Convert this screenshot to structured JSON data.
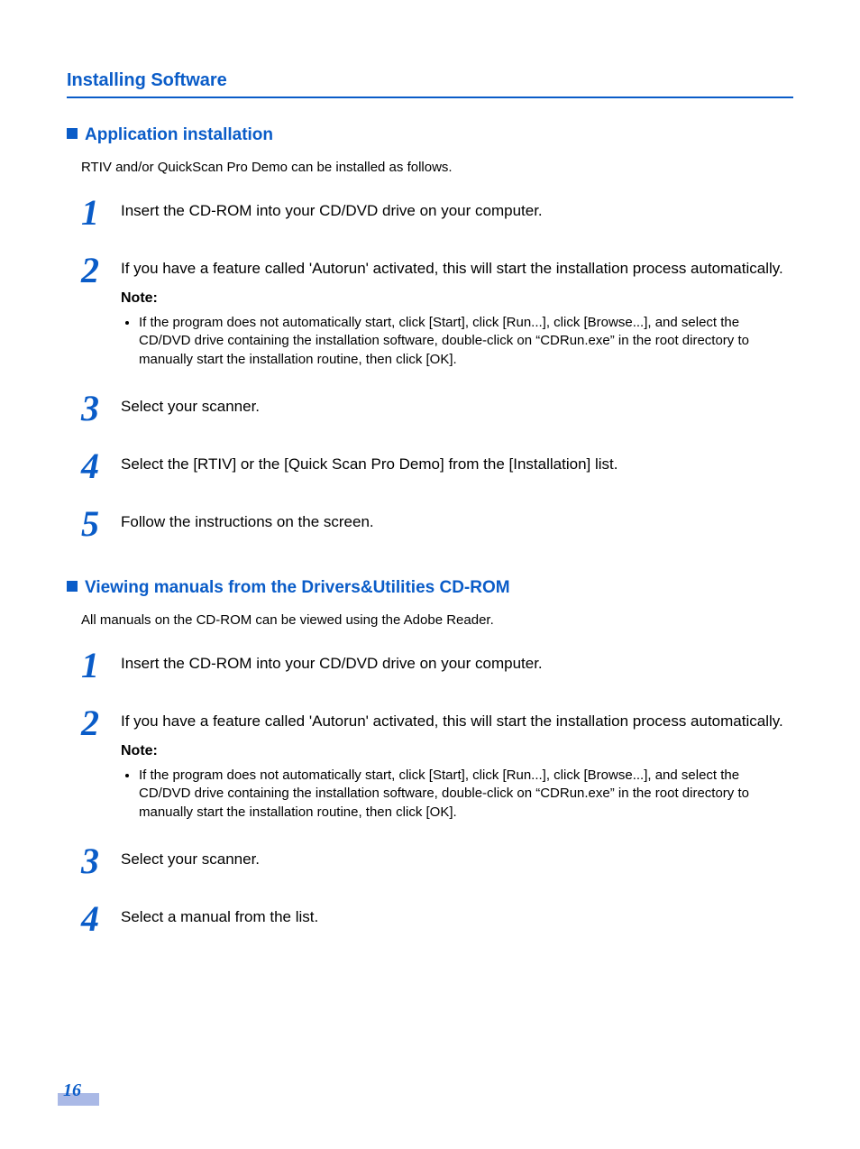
{
  "heading": "Installing Software",
  "section1": {
    "title": "Application installation",
    "intro": "RTIV and/or QuickScan Pro Demo can be installed as follows.",
    "steps": [
      {
        "num": "1",
        "text": "Insert the CD-ROM into your CD/DVD drive on your computer."
      },
      {
        "num": "2",
        "text": "If you have a feature called 'Autorun' activated, this will start the installation process automatically.",
        "note_label": "Note:",
        "note_item": "If the program does not automatically start, click [Start], click [Run...], click [Browse...], and select the CD/DVD drive containing the installation software, double-click on “CDRun.exe” in the root directory to manually start the installation routine, then click [OK]."
      },
      {
        "num": "3",
        "text": "Select your scanner."
      },
      {
        "num": "4",
        "text": "Select the [RTIV] or the [Quick Scan Pro Demo] from the [Installation] list."
      },
      {
        "num": "5",
        "text": "Follow the instructions on the screen."
      }
    ]
  },
  "section2": {
    "title": "Viewing manuals from the Drivers&Utilities CD-ROM",
    "intro": "All manuals on the CD-ROM can be viewed using the Adobe Reader.",
    "steps": [
      {
        "num": "1",
        "text": "Insert the CD-ROM into your CD/DVD drive on your computer."
      },
      {
        "num": "2",
        "text": "If you have a feature called 'Autorun' activated, this will start the installation process automatically.",
        "note_label": "Note:",
        "note_item": "If the program does not automatically start, click [Start], click [Run...], click [Browse...], and select the CD/DVD drive containing the installation software, double-click on “CDRun.exe” in the root directory to manually start the installation routine, then click [OK]."
      },
      {
        "num": "3",
        "text": "Select your scanner."
      },
      {
        "num": "4",
        "text": "Select a manual from the list."
      }
    ]
  },
  "page_number": "16"
}
